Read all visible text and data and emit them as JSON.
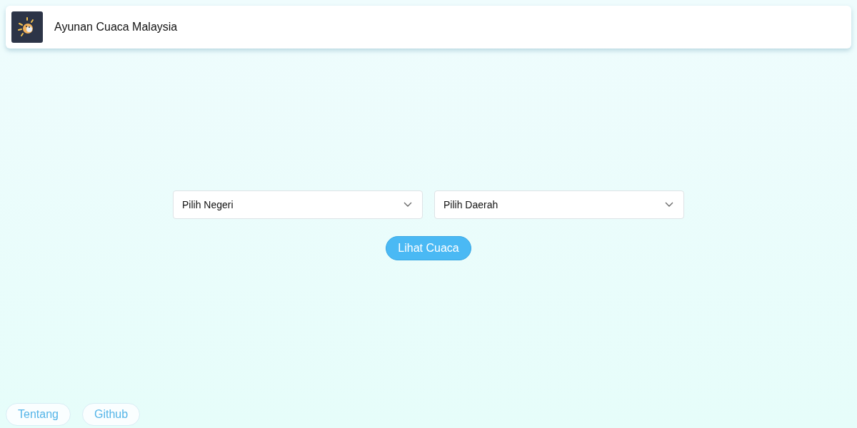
{
  "header": {
    "title": "Ayunan Cuaca Malaysia"
  },
  "selects": [
    {
      "placeholder": "Pilih Negeri"
    },
    {
      "placeholder": "Pilih Daerah"
    }
  ],
  "submit_button": "Lihat Cuaca",
  "footer_links": [
    "Tentang",
    "Github"
  ]
}
